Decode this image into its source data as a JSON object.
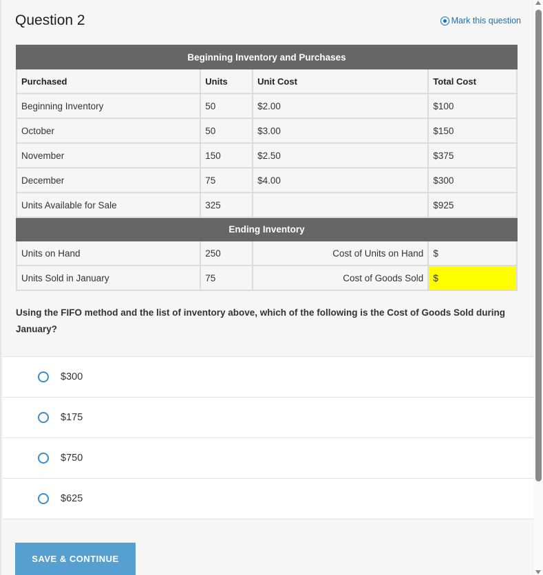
{
  "header": {
    "title": "Question 2",
    "mark_label": "Mark this question"
  },
  "table": {
    "section1_title": "Beginning Inventory and Purchases",
    "columns": [
      "Purchased",
      "Units",
      "Unit Cost",
      "Total Cost"
    ],
    "rows": [
      {
        "label": "Beginning Inventory",
        "units": "50",
        "unit_cost": "$2.00",
        "total_cost": "$100"
      },
      {
        "label": "October",
        "units": "50",
        "unit_cost": "$3.00",
        "total_cost": "$150"
      },
      {
        "label": "November",
        "units": "150",
        "unit_cost": "$2.50",
        "total_cost": "$375"
      },
      {
        "label": "December",
        "units": "75",
        "unit_cost": "$4.00",
        "total_cost": "$300"
      },
      {
        "label": "Units Available for Sale",
        "units": "325",
        "unit_cost": "",
        "total_cost": "$925"
      }
    ],
    "section2_title": "Ending Inventory",
    "ending_rows": [
      {
        "label": "Units on Hand",
        "units": "250",
        "cost_label": "Cost of Units on Hand",
        "cost_value": "$"
      },
      {
        "label": "Units Sold in January",
        "units": "75",
        "cost_label": "Cost of Goods Sold",
        "cost_value": "$"
      }
    ],
    "highlight_color": "#ffff00"
  },
  "question": {
    "text": "Using the FIFO method and the list of inventory above, which of the following is the Cost of Goods Sold during January?"
  },
  "answers": [
    {
      "label": "$300",
      "selected": false
    },
    {
      "label": "$175",
      "selected": false
    },
    {
      "label": "$750",
      "selected": false
    },
    {
      "label": "$625",
      "selected": false
    }
  ],
  "footer": {
    "save_label": "SAVE & CONTINUE"
  },
  "colors": {
    "accent": "#1d6fb8",
    "button": "#55a0d0",
    "table_header": "#666666"
  }
}
